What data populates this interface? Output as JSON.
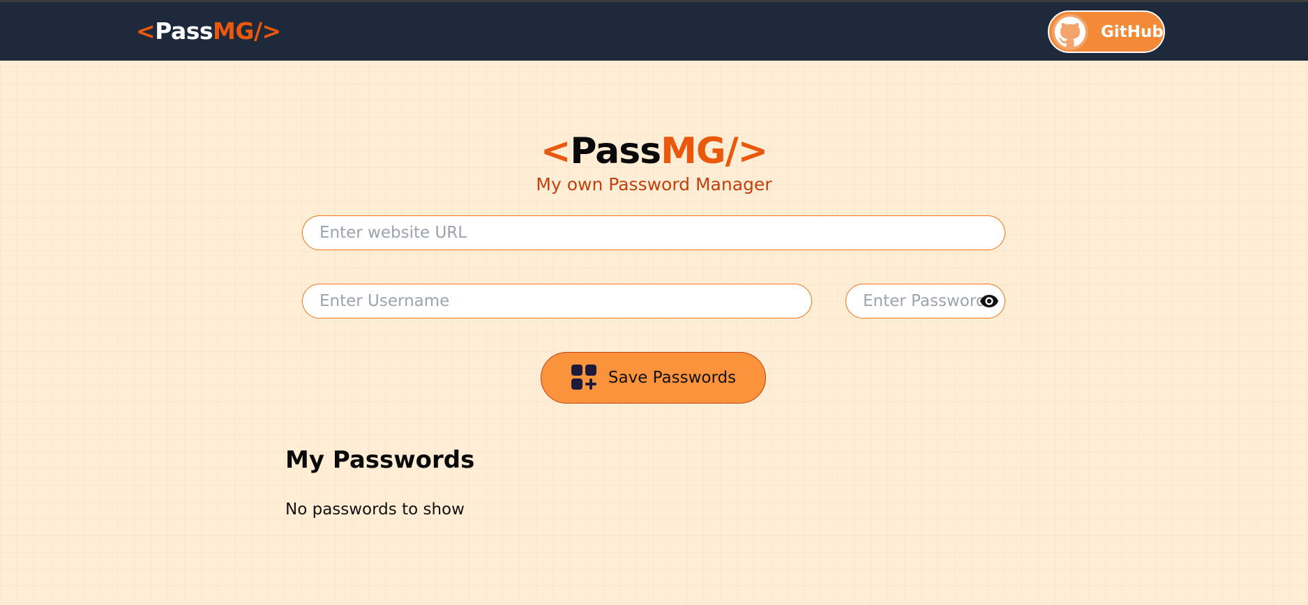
{
  "brand": {
    "open_bracket": "<",
    "name_part1": "Pass",
    "name_part2": "MG/",
    "close_bracket": ">"
  },
  "nav": {
    "github_label": "GitHub",
    "github_icon": "github-icon"
  },
  "hero": {
    "subtitle": "My own Password Manager"
  },
  "form": {
    "url_placeholder": "Enter website URL",
    "url_value": "",
    "username_placeholder": "Enter Username",
    "username_value": "",
    "password_placeholder": "Enter Password",
    "password_value": "",
    "show_password_icon": "eye-icon",
    "save_label": "Save Passwords",
    "save_icon": "add-grid-icon"
  },
  "passwords": {
    "heading": "My Passwords",
    "empty_message": "No passwords to show",
    "items": []
  },
  "colors": {
    "nav_bg": "#1e293b",
    "page_bg": "#ffedd5",
    "accent": "#ea580c",
    "button": "#fb923c",
    "subtitle": "#c2410c"
  }
}
